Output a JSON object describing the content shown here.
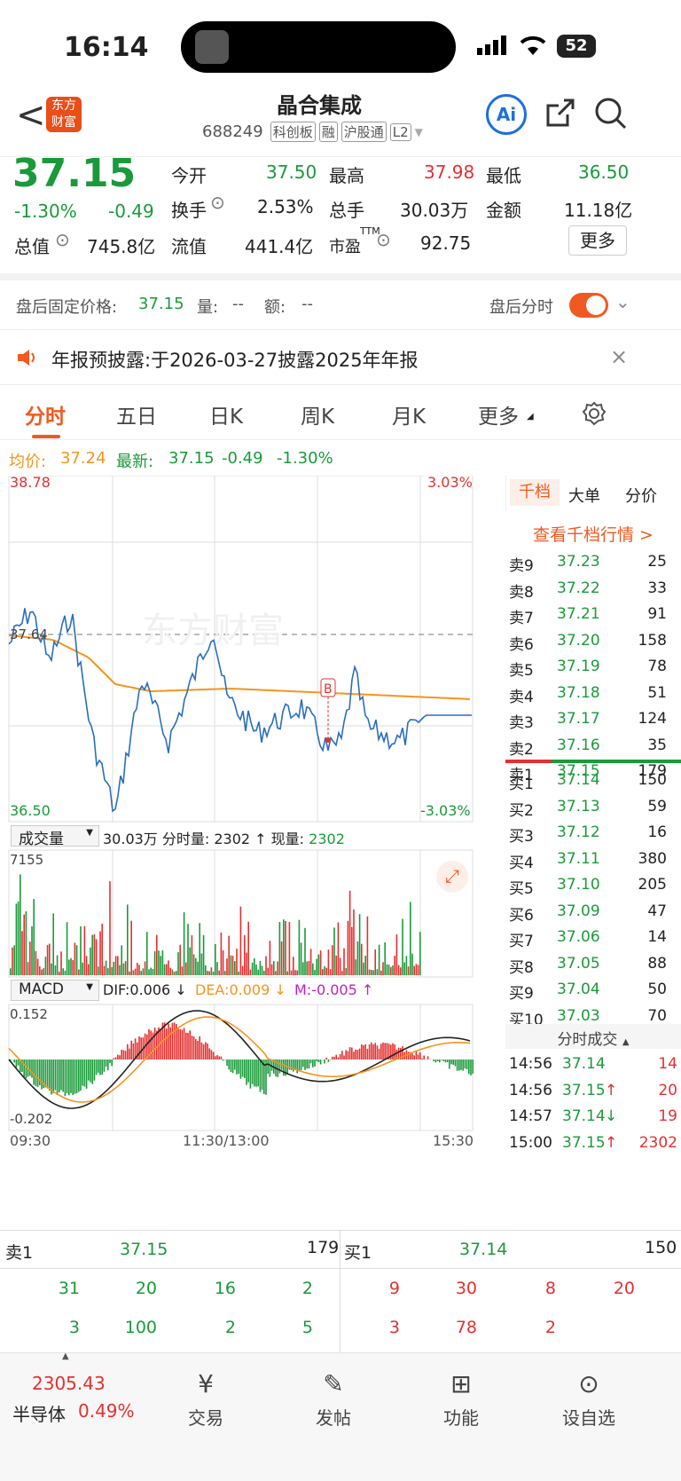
{
  "status": {
    "time": "16:14",
    "battery": "52"
  },
  "nav": {
    "back": "<",
    "logo_line1": "东方",
    "logo_line2": "财富",
    "name": "晶合集成",
    "code": "688249",
    "tags": [
      "科创板",
      "融",
      "沪股通",
      "L2"
    ],
    "ai": "Ai"
  },
  "quote": {
    "price": "37.15",
    "pct": "-1.30%",
    "chg": "-0.49",
    "open_l": "今开",
    "open_v": "37.50",
    "high_l": "最高",
    "high_v": "37.98",
    "low_l": "最低",
    "low_v": "36.50",
    "turn_l": "换手",
    "turn_v": "2.53%",
    "vol_l": "总手",
    "vol_v": "30.03万",
    "amt_l": "金额",
    "amt_v": "11.18亿",
    "cap_l": "总值",
    "cap_v": "745.8亿",
    "float_l": "流值",
    "float_v": "441.4亿",
    "pe_l": "市盈",
    "pe_sup": "TTM",
    "pe_v": "92.75",
    "more": "更多"
  },
  "after": {
    "label": "盘后固定价格:",
    "price": "37.15",
    "vol_l": "量:",
    "vol_v": "--",
    "amt_l": "额:",
    "amt_v": "--",
    "toggle_label": "盘后分时"
  },
  "notice": {
    "text": "年报预披露:于2026-03-27披露2025年年报"
  },
  "tabs": [
    "分时",
    "五日",
    "日K",
    "周K",
    "月K",
    "更多"
  ],
  "avg": {
    "avg_l": "均价:",
    "avg_v": "37.24",
    "last_l": "最新:",
    "last_v": "37.15",
    "chg": "-0.49",
    "pct": "-1.30%"
  },
  "chart": {
    "ymax": "38.78",
    "ymin": "36.50",
    "mid": "37.64",
    "pmax": "3.03%",
    "pmin": "-3.03%",
    "watermark": "东方财富",
    "vol_sel": "成交量",
    "vol_info": "30.03万 分时量: 2302 ↑ 现量: ",
    "vol_cur": "2302",
    "vol_max": "7155",
    "macd_sel": "MACD",
    "dif": "DIF:0.006 ↓",
    "dea": "DEA:0.009 ↓",
    "m": "M:-0.005 ↑",
    "macd_max": "0.152",
    "macd_min": "-0.202",
    "t0": "09:30",
    "t1": "11:30/13:00",
    "t2": "15:30"
  },
  "depth": {
    "tabs": [
      "千档",
      "大单",
      "分价"
    ],
    "link": "查看千档行情 >",
    "asks": [
      [
        "卖9",
        "37.23",
        "25"
      ],
      [
        "卖8",
        "37.22",
        "33"
      ],
      [
        "卖7",
        "37.21",
        "91"
      ],
      [
        "卖6",
        "37.20",
        "158"
      ],
      [
        "卖5",
        "37.19",
        "78"
      ],
      [
        "卖4",
        "37.18",
        "51"
      ],
      [
        "卖3",
        "37.17",
        "124"
      ],
      [
        "卖2",
        "37.16",
        "35"
      ],
      [
        "卖1",
        "37.15",
        "179"
      ]
    ],
    "bids": [
      [
        "买1",
        "37.14",
        "150"
      ],
      [
        "买2",
        "37.13",
        "59"
      ],
      [
        "买3",
        "37.12",
        "16"
      ],
      [
        "买4",
        "37.11",
        "380"
      ],
      [
        "买5",
        "37.10",
        "205"
      ],
      [
        "买6",
        "37.09",
        "47"
      ],
      [
        "买7",
        "37.06",
        "14"
      ],
      [
        "买8",
        "37.05",
        "88"
      ],
      [
        "买9",
        "37.04",
        "50"
      ],
      [
        "买10",
        "37.03",
        "70"
      ]
    ],
    "trade_title": "分时成交",
    "trades": [
      [
        "14:56",
        "37.14",
        "",
        "14"
      ],
      [
        "14:56",
        "37.15",
        "↑",
        "20"
      ],
      [
        "14:57",
        "37.14",
        "↓",
        "19"
      ],
      [
        "15:00",
        "37.15",
        "↑",
        "2302"
      ]
    ]
  },
  "bottom": {
    "sell_l": "卖1",
    "sell_p": "37.15",
    "sell_v": "179",
    "buy_l": "买1",
    "buy_p": "37.14",
    "buy_v": "150",
    "sell_r1": [
      "31",
      "20",
      "16",
      "2"
    ],
    "sell_r2": [
      "3",
      "100",
      "2",
      "5"
    ],
    "buy_r1": [
      "9",
      "30",
      "8",
      "20"
    ],
    "buy_r2": [
      "3",
      "78",
      "2"
    ]
  },
  "tabbar": {
    "index_v": "2305.43",
    "index_name": "半导体",
    "index_pct": "0.49%",
    "items": [
      "交易",
      "发帖",
      "功能",
      "设自选"
    ]
  }
}
